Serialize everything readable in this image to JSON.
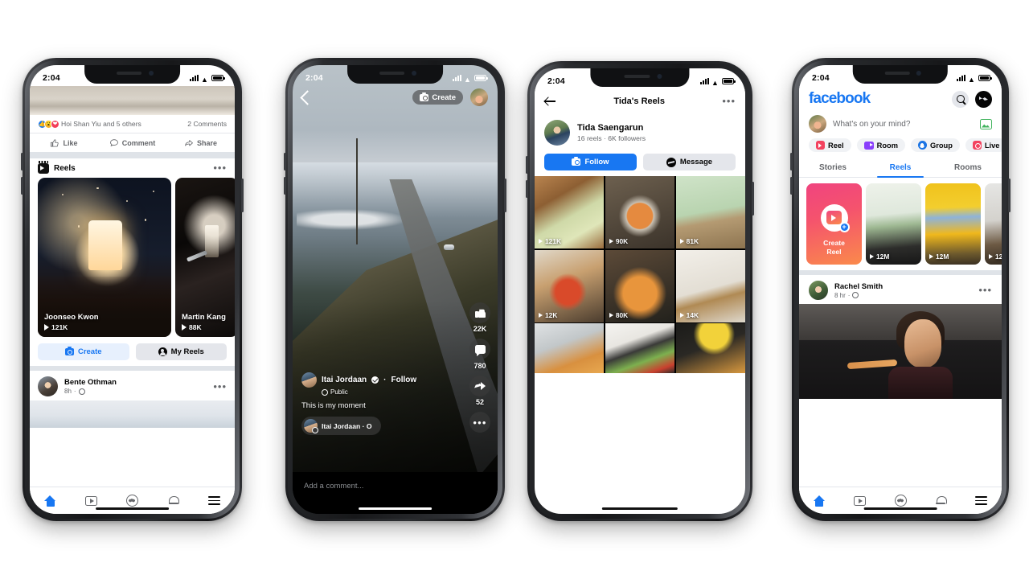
{
  "meta": {
    "status_time": "2:04"
  },
  "phone1": {
    "name": "facebook-feed-reels-unit",
    "post_top": {
      "reactions_text": "Hoi Shan Yiu and 5 others",
      "comments_text": "2 Comments",
      "actions": [
        "Like",
        "Comment",
        "Share"
      ]
    },
    "reels_unit": {
      "title": "Reels",
      "menu": "•••",
      "cards": [
        {
          "name": "Joonseo Kwon",
          "plays": "121K"
        },
        {
          "name": "Martin Kang",
          "plays": "88K"
        }
      ],
      "buttons": {
        "create": "Create",
        "my_reels": "My Reels"
      }
    },
    "next_post": {
      "author": "Bente Othman",
      "time": "8h"
    },
    "tabs": [
      "home-icon",
      "watch-icon",
      "groups-icon",
      "notifications-icon",
      "menu-icon"
    ]
  },
  "phone2": {
    "name": "reels-player",
    "top": {
      "back": "back-chevron",
      "create_label": "Create"
    },
    "actions": [
      {
        "icon": "thumbs-up-icon",
        "count": "22K"
      },
      {
        "icon": "comment-icon",
        "count": "780"
      },
      {
        "icon": "share-icon",
        "count": "52"
      },
      {
        "icon": "more-icon",
        "count": ""
      }
    ],
    "info": {
      "author": "Itai Jordaan",
      "verified": true,
      "follow_label": "Follow",
      "privacy": "Public",
      "caption": "This is my moment",
      "audio": "Itai Jordaan · O"
    },
    "comment_placeholder": "Add a comment..."
  },
  "phone3": {
    "name": "reels-profile",
    "nav_title": "Tida's Reels",
    "menu": "•••",
    "profile": {
      "name": "Tida Saengarun",
      "stats": "16 reels · 6K followers"
    },
    "buttons": {
      "follow": "Follow",
      "message": "Message"
    },
    "grid": [
      {
        "plays": "121K"
      },
      {
        "plays": "90K"
      },
      {
        "plays": "81K"
      },
      {
        "plays": "12K"
      },
      {
        "plays": "80K"
      },
      {
        "plays": "14K"
      },
      {
        "plays": ""
      },
      {
        "plays": ""
      },
      {
        "plays": ""
      }
    ]
  },
  "phone4": {
    "name": "facebook-home-reels-tray",
    "logo": "facebook",
    "composer_placeholder": "What's on your mind?",
    "chips": [
      {
        "label": "Reel",
        "icon": "reel-icon"
      },
      {
        "label": "Room",
        "icon": "room-icon"
      },
      {
        "label": "Group",
        "icon": "group-icon"
      },
      {
        "label": "Live",
        "icon": "live-icon"
      }
    ],
    "segments": [
      {
        "label": "Stories",
        "active": false
      },
      {
        "label": "Reels",
        "active": true
      },
      {
        "label": "Rooms",
        "active": false
      }
    ],
    "tray": {
      "create_line1": "Create",
      "create_line2": "Reel",
      "items": [
        {
          "plays": "12M"
        },
        {
          "plays": "12M"
        },
        {
          "plays": "12"
        }
      ]
    },
    "post": {
      "author": "Rachel Smith",
      "time": "8 hr"
    },
    "tabs": [
      "home-icon",
      "watch-icon",
      "groups-icon",
      "notifications-icon",
      "menu-icon"
    ]
  },
  "colors": {
    "fb_blue": "#1877f2",
    "grey_bg": "#e4e6eb",
    "light_blue_bg": "#e7f0fd",
    "text_primary": "#050505",
    "text_secondary": "#65676b"
  }
}
